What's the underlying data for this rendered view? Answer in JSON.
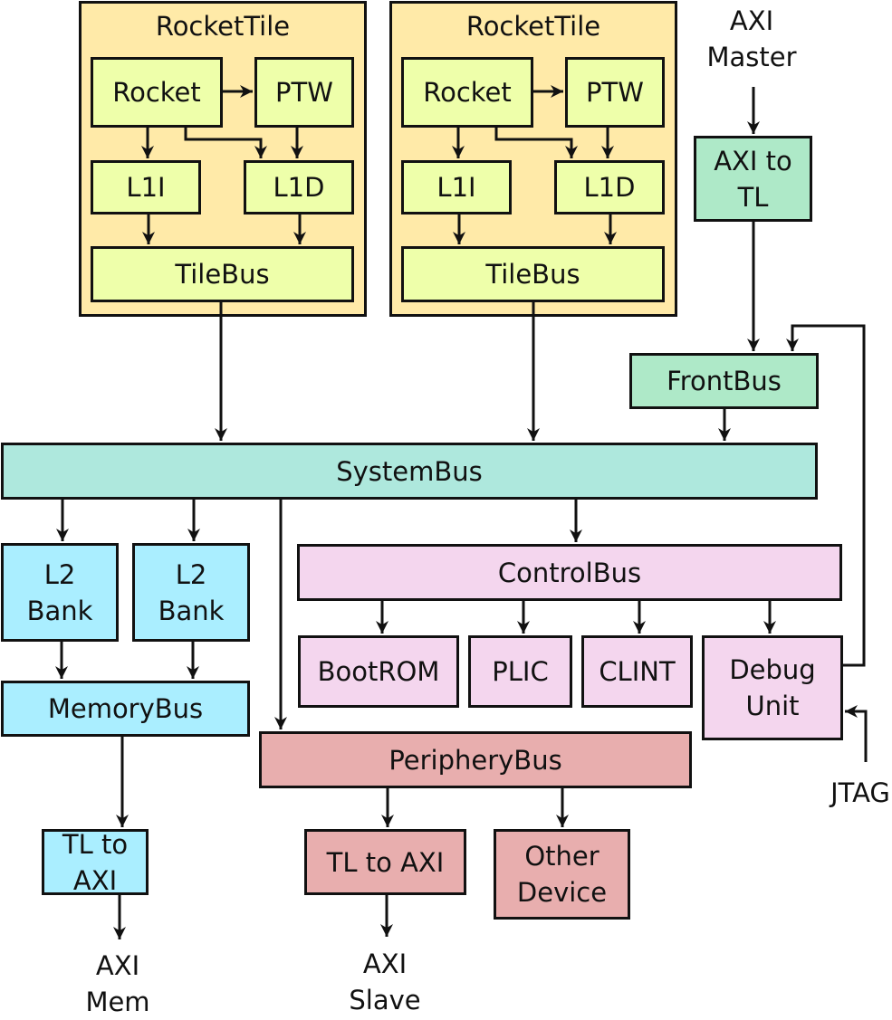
{
  "colors": {
    "tile_bg": "#ffeaa8",
    "core_bg": "#eeffaa",
    "front_bg": "#aee9c8",
    "system_bg": "#aee8dd",
    "memory_bg": "#aaeeff",
    "control_bg": "#f4d6ee",
    "periphery_bg": "#e8aeae"
  },
  "tiles": [
    {
      "title": "RocketTile",
      "rocket": "Rocket",
      "ptw": "PTW",
      "l1i": "L1I",
      "l1d": "L1D",
      "tilebus": "TileBus"
    },
    {
      "title": "RocketTile",
      "rocket": "Rocket",
      "ptw": "PTW",
      "l1i": "L1I",
      "l1d": "L1D",
      "tilebus": "TileBus"
    }
  ],
  "front": {
    "axi_master": "AXI\nMaster",
    "axi_to_tl": "AXI to\nTL",
    "frontbus": "FrontBus"
  },
  "systembus": "SystemBus",
  "memory": {
    "l2_banks": [
      "L2\nBank",
      "L2\nBank"
    ],
    "memorybus": "MemoryBus",
    "tl_to_axi": "TL to AXI",
    "axi_mem": "AXI\nMem"
  },
  "control": {
    "controlbus": "ControlBus",
    "bootrom": "BootROM",
    "plic": "PLIC",
    "clint": "CLINT",
    "debug_unit": "Debug\nUnit",
    "jtag": "JTAG"
  },
  "periphery": {
    "peripherybus": "PeripheryBus",
    "tl_to_axi": "TL to AXI",
    "other_device": "Other\nDevice",
    "axi_slave": "AXI\nSlave"
  }
}
